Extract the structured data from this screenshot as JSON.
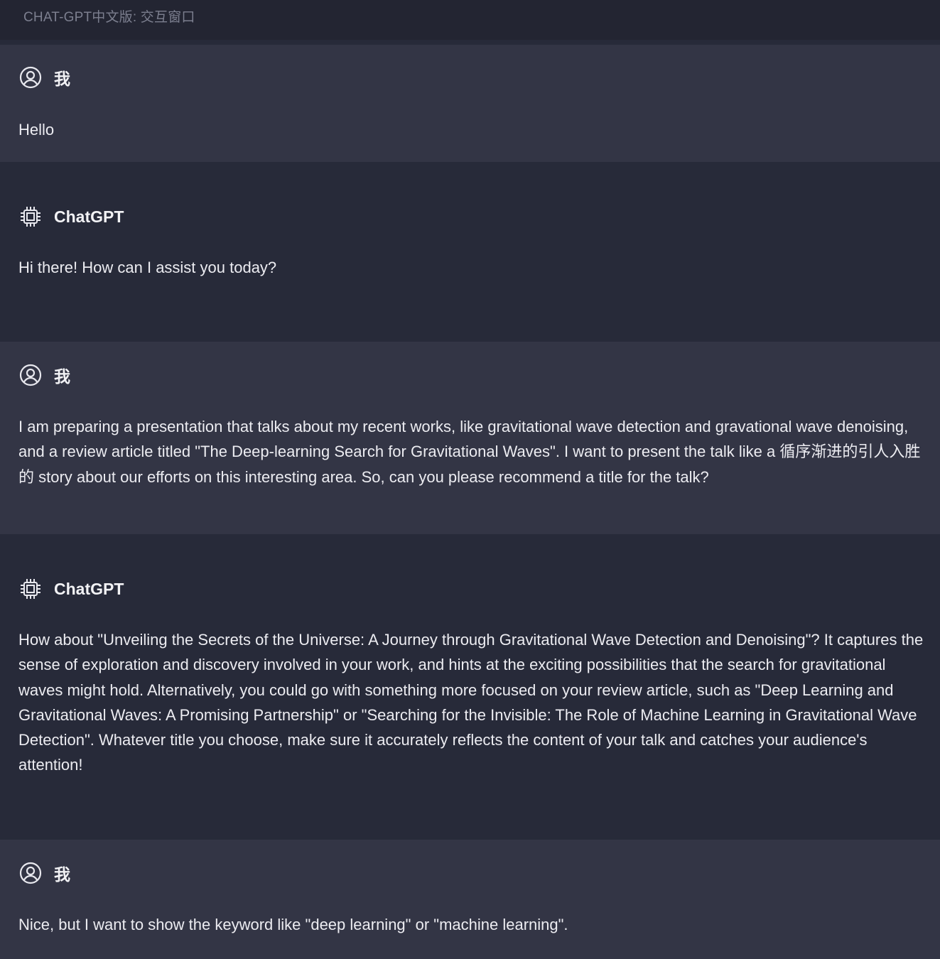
{
  "window": {
    "title": "CHAT-GPT中文版: 交互窗口"
  },
  "icons": {
    "user": "user-circle-icon",
    "bot": "chip-icon"
  },
  "colors": {
    "background": "#272a39",
    "user_message_bg": "#333545",
    "titlebar_bg": "#232532",
    "text": "#ececf1",
    "title_text": "#7c7f8f"
  },
  "messages": [
    {
      "role": "user",
      "author": "我",
      "text": "Hello"
    },
    {
      "role": "assistant",
      "author": "ChatGPT",
      "text": "Hi there! How can I assist you today?"
    },
    {
      "role": "user",
      "author": "我",
      "text": "I am preparing a presentation that talks about my recent works, like gravitational wave detection and gravational wave denoising, and a review article titled \"The Deep-learning Search for Gravitational Waves\". I want to present the talk like a 循序渐进的引人入胜的 story about our efforts on this interesting area. So, can you please recommend a title for the talk?"
    },
    {
      "role": "assistant",
      "author": "ChatGPT",
      "text": "How about \"Unveiling the Secrets of the Universe: A Journey through Gravitational Wave Detection and Denoising\"? It captures the sense of exploration and discovery involved in your work, and hints at the exciting possibilities that the search for gravitational waves might hold. Alternatively, you could go with something more focused on your review article, such as \"Deep Learning and Gravitational Waves: A Promising Partnership\" or \"Searching for the Invisible: The Role of Machine Learning in Gravitational Wave Detection\". Whatever title you choose, make sure it accurately reflects the content of your talk and catches your audience's attention!"
    },
    {
      "role": "user",
      "author": "我",
      "text": "Nice, but I want to show the keyword like \"deep learning\" or \"machine learning\"."
    }
  ]
}
